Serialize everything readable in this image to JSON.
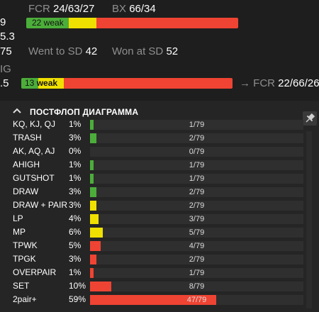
{
  "top": {
    "fcr_label": "FCR",
    "fcr_value": "24/63/27",
    "bx_label": "BX",
    "bx_value": "66/34",
    "row1_left": "9",
    "bar1": {
      "label": "22 weak",
      "green_pct": 20,
      "yellow_pct": 13
    },
    "row2_left": "5.3",
    "row3_left": "75",
    "went_label": "Went to SD",
    "went_value": "42",
    "won_label": "Won at SD",
    "won_value": "52",
    "row4_left": "IG",
    "row5_left": ".5",
    "bar2": {
      "label_num": "13",
      "label_word": "weak",
      "green_pct": 8,
      "yellow_pct": 12
    },
    "arrow": "→",
    "fcr2_label": "FCR",
    "fcr2_value": "22/66/26"
  },
  "panel": {
    "title": "ПОСТФЛОП ДИАГРАММА",
    "colors": {
      "green": "#4cae3a",
      "yellow": "#f0e000",
      "red": "#ef4433"
    },
    "rows": [
      {
        "label": "KQ, KJ, QJ",
        "pct": "1%",
        "count": "1/79",
        "fill": 1,
        "color": "green"
      },
      {
        "label": "TRASH",
        "pct": "3%",
        "count": "2/79",
        "fill": 3,
        "color": "green"
      },
      {
        "label": "AK, AQ, AJ",
        "pct": "0%",
        "count": "0/79",
        "fill": 0,
        "color": "green"
      },
      {
        "label": "AHIGH",
        "pct": "1%",
        "count": "1/79",
        "fill": 1,
        "color": "green"
      },
      {
        "label": "GUTSHOT",
        "pct": "1%",
        "count": "1/79",
        "fill": 1,
        "color": "green"
      },
      {
        "label": "DRAW",
        "pct": "3%",
        "count": "2/79",
        "fill": 3,
        "color": "green"
      },
      {
        "label": "DRAW + PAIR",
        "pct": "3%",
        "count": "2/79",
        "fill": 3,
        "color": "yellow"
      },
      {
        "label": "LP",
        "pct": "4%",
        "count": "3/79",
        "fill": 4,
        "color": "yellow"
      },
      {
        "label": "MP",
        "pct": "6%",
        "count": "5/79",
        "fill": 6,
        "color": "yellow"
      },
      {
        "label": "TPWK",
        "pct": "5%",
        "count": "4/79",
        "fill": 5,
        "color": "red"
      },
      {
        "label": "TPGK",
        "pct": "3%",
        "count": "2/79",
        "fill": 3,
        "color": "red"
      },
      {
        "label": "OVERPAIR",
        "pct": "1%",
        "count": "1/79",
        "fill": 1,
        "color": "red"
      },
      {
        "label": "SET",
        "pct": "10%",
        "count": "8/79",
        "fill": 10,
        "color": "red"
      },
      {
        "label": "2pair+",
        "pct": "59%",
        "count": "47/79",
        "fill": 59,
        "color": "red"
      }
    ]
  }
}
